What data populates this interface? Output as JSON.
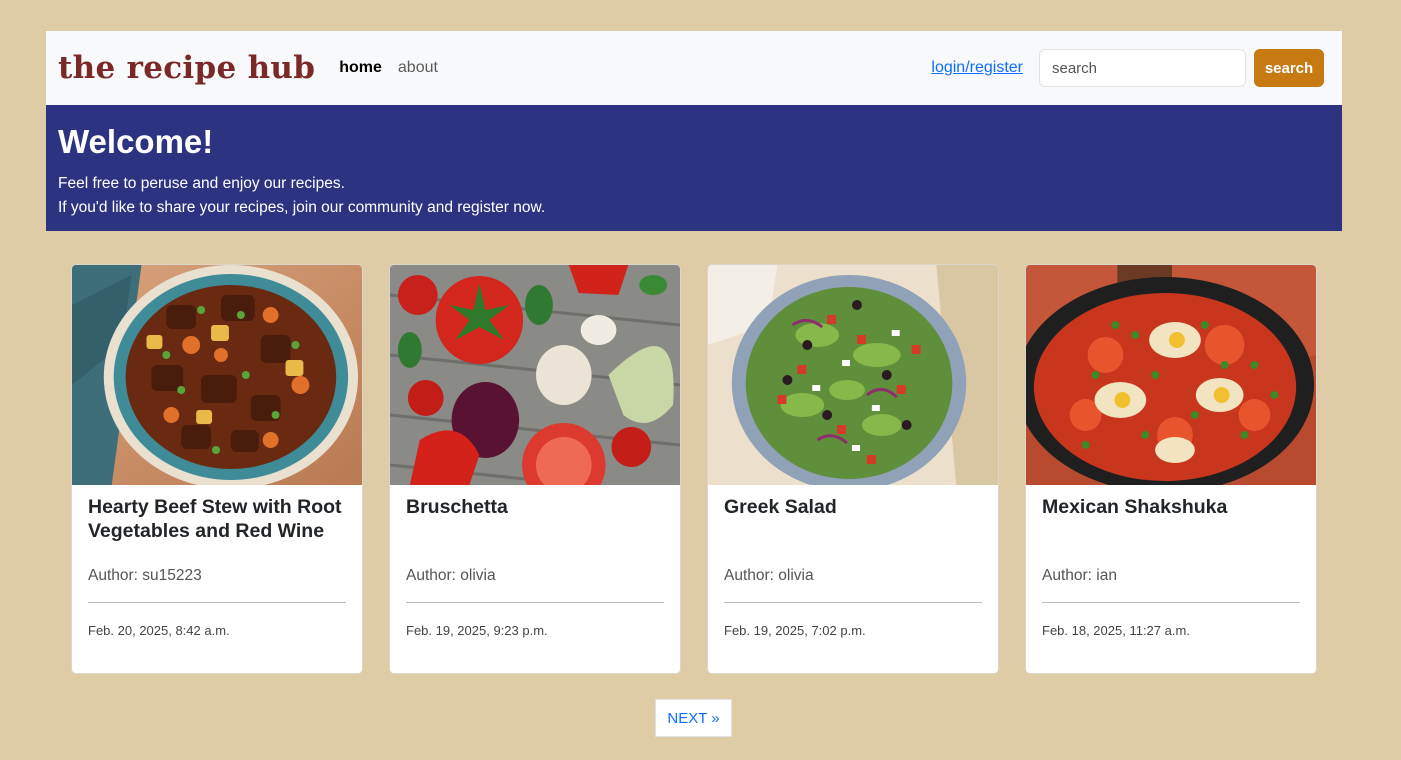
{
  "nav": {
    "brand": "the recipe hub",
    "links": [
      "home",
      "about"
    ],
    "login": "login/register",
    "search_placeholder": "search",
    "search_button": "search"
  },
  "hero": {
    "title": "Welcome!",
    "line1": "Feel free to peruse and enjoy our recipes.",
    "line2": "If you'd like to share your recipes, join our community and register now."
  },
  "recipes": [
    {
      "title": "Hearty Beef Stew with Root Vegetables and Red Wine",
      "author": "Author: su15223",
      "date": "Feb. 20, 2025, 8:42 a.m.",
      "image": "beef-stew-photo"
    },
    {
      "title": "Bruschetta",
      "author": "Author: olivia",
      "date": "Feb. 19, 2025, 9:23 p.m.",
      "image": "tomatoes-vegetables-photo"
    },
    {
      "title": "Greek Salad",
      "author": "Author: olivia",
      "date": "Feb. 19, 2025, 7:02 p.m.",
      "image": "greek-salad-photo"
    },
    {
      "title": "Mexican Shakshuka",
      "author": "Author: ian",
      "date": "Feb. 18, 2025, 11:27 a.m.",
      "image": "shakshuka-photo"
    }
  ],
  "pagination": {
    "next": "NEXT »"
  },
  "colors": {
    "background": "#dfcba6",
    "brand": "#7a2828",
    "hero": "#2c3482",
    "accent": "#c77a12",
    "link": "#0d6efd"
  }
}
